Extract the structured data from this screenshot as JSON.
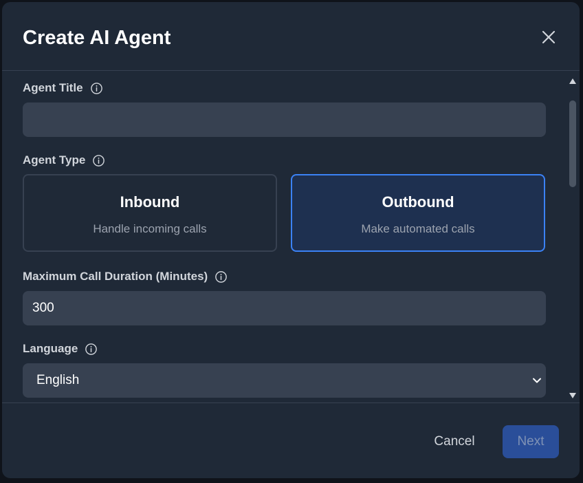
{
  "modal": {
    "title": "Create AI Agent",
    "close_icon": "close-icon"
  },
  "form": {
    "agent_title": {
      "label": "Agent Title",
      "value": "",
      "placeholder": "",
      "info_icon": "info-icon"
    },
    "agent_type": {
      "label": "Agent Type",
      "info_icon": "info-icon",
      "selected": "Outbound",
      "options": [
        {
          "title": "Inbound",
          "description": "Handle incoming calls"
        },
        {
          "title": "Outbound",
          "description": "Make automated calls"
        }
      ]
    },
    "max_call_duration": {
      "label": "Maximum Call Duration (Minutes)",
      "value": "300",
      "info_icon": "info-icon"
    },
    "language": {
      "label": "Language",
      "selected_value": "English",
      "info_icon": "info-icon",
      "dropdown_icon": "chevron-down-icon"
    }
  },
  "footer": {
    "cancel_label": "Cancel",
    "next_label": "Next"
  },
  "colors": {
    "modal_background": "#1f2937",
    "input_background": "#374151",
    "accent_border": "#3b82f6",
    "selected_card_background": "#1e3050",
    "next_button_background": "#2a4e99"
  }
}
